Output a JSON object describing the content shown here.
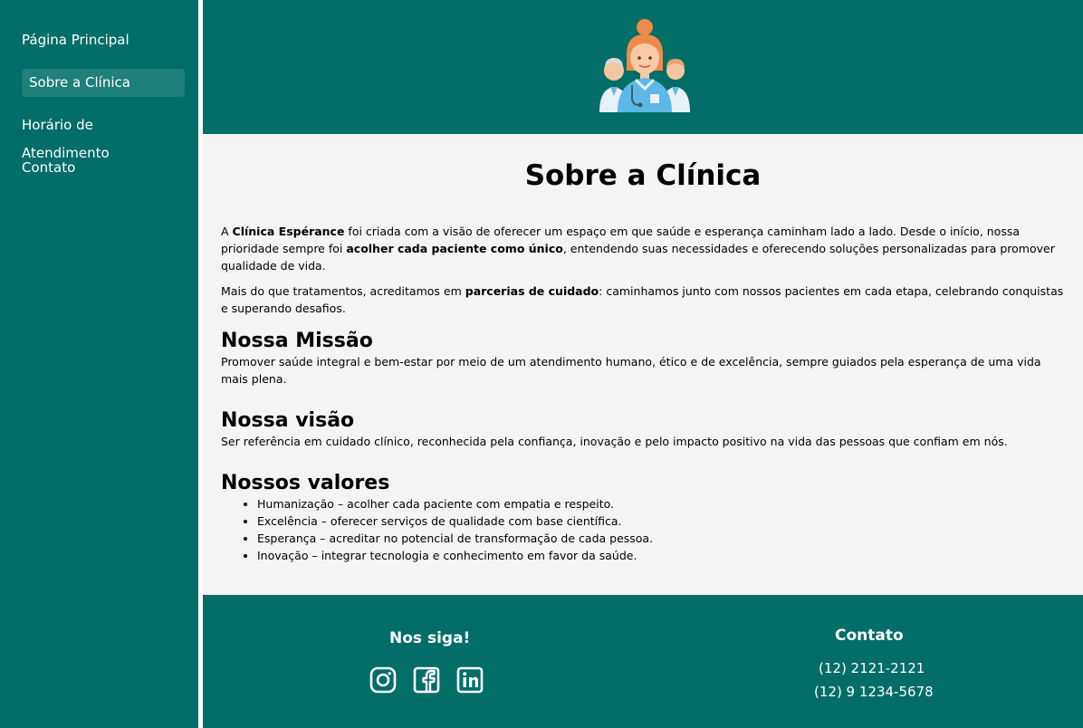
{
  "sidebar": {
    "items": [
      {
        "label": "Página Principal"
      },
      {
        "label": "Sobre a Clínica"
      },
      {
        "label": "Horário de Atendimento"
      },
      {
        "label": "Contato"
      }
    ],
    "active_index": 1
  },
  "content": {
    "title": "Sobre a Clínica",
    "intro": {
      "p1_a": "A ",
      "p1_b": "Clínica Espérance",
      "p1_c": " foi criada com a visão de oferecer um espaço em que saúde e esperança caminham lado a lado. Desde o início, nossa prioridade sempre foi ",
      "p1_d": "acolher cada paciente como único",
      "p1_e": ", entendendo suas necessidades e oferecendo soluções personalizadas para promover qualidade de vida.",
      "p2_a": "Mais do que tratamentos, acreditamos em ",
      "p2_b": "parcerias de cuidado",
      "p2_c": ": caminhamos junto com nossos pacientes em cada etapa, celebrando conquistas e superando desafios."
    },
    "mission": {
      "heading": "Nossa Missão",
      "text": "Promover saúde integral e bem-estar por meio de um atendimento humano, ético e de excelência, sempre guiados pela esperança de uma vida mais plena."
    },
    "vision": {
      "heading": "Nossa visão",
      "text": "Ser referência em cuidado clínico, reconhecida pela confiança, inovação e pelo impacto positivo na vida das pessoas que confiam em nós."
    },
    "values": {
      "heading": "Nossos valores",
      "items": [
        "Humanização – acolher cada paciente com empatia e respeito.",
        "Excelência – oferecer serviços de qualidade com base científica.",
        "Esperança – acreditar no potencial de transformação de cada pessoa.",
        "Inovação – integrar tecnologia e conhecimento em favor da saúde."
      ]
    }
  },
  "footer": {
    "social_title": "Nos siga!",
    "icons": [
      "instagram-icon",
      "facebook-icon",
      "linkedin-icon"
    ],
    "contact_title": "Contato",
    "phones": [
      "(12) 2121-2121",
      "(12) 9 1234-5678"
    ]
  },
  "colors": {
    "primary": "#036d68",
    "active_item": "#1f7f79",
    "content_bg": "#f4f4f4"
  }
}
